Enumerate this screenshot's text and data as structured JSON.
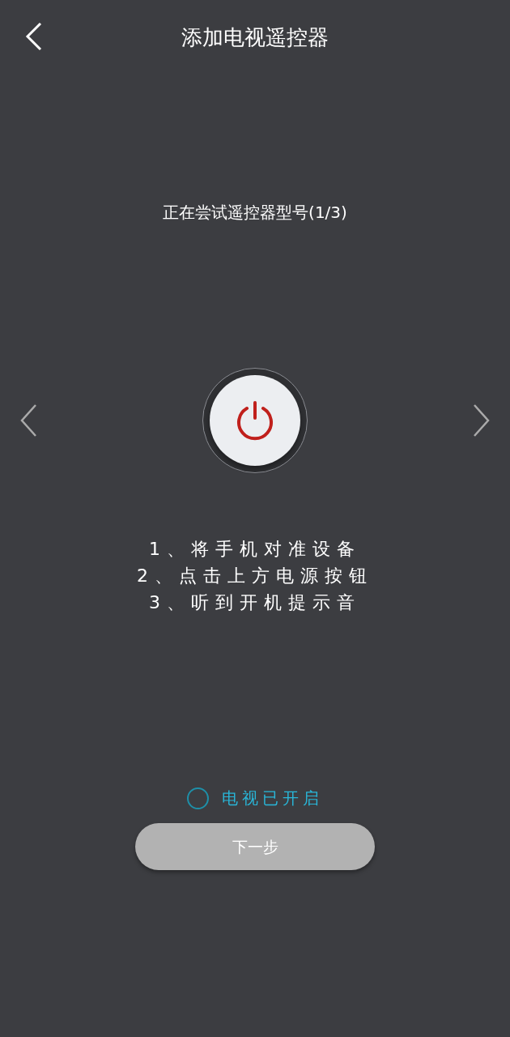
{
  "header": {
    "title": "添加电视遥控器"
  },
  "status": "正在尝试遥控器型号(1/3)",
  "steps": [
    "1、将手机对准设备",
    "2、点击上方电源按钮",
    "3、听到开机提示音"
  ],
  "confirm": {
    "label": "电视已开启",
    "checked": false
  },
  "next_button": {
    "label": "下一步",
    "disabled": true
  }
}
